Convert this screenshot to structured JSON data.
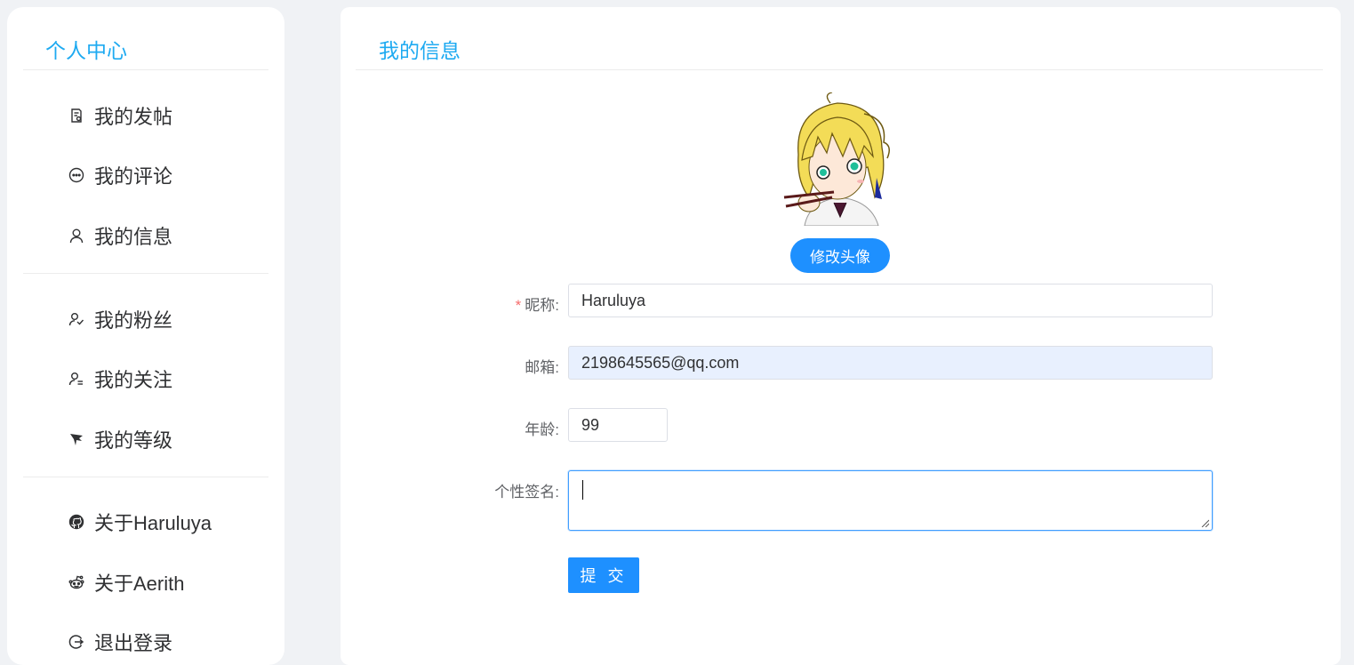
{
  "sidebar": {
    "title": "个人中心",
    "items": [
      {
        "label": "我的发帖",
        "icon": "document-icon"
      },
      {
        "label": "我的评论",
        "icon": "chat-bubble-icon"
      },
      {
        "label": "我的信息",
        "icon": "user-icon"
      },
      {
        "label": "我的粉丝",
        "icon": "followers-icon"
      },
      {
        "label": "我的关注",
        "icon": "following-icon"
      },
      {
        "label": "我的等级",
        "icon": "level-icon"
      },
      {
        "label": "关于Haruluya",
        "icon": "github-icon"
      },
      {
        "label": "关于Aerith",
        "icon": "reddit-icon"
      },
      {
        "label": "退出登录",
        "icon": "logout-icon"
      }
    ]
  },
  "main": {
    "title": "我的信息",
    "avatar_alt": "anime-character-avatar",
    "change_avatar_label": "修改头像",
    "form": {
      "nickname_label": "昵称:",
      "nickname_required_mark": "*",
      "nickname_value": "Haruluya",
      "email_label": "邮箱:",
      "email_value": "2198645565@qq.com",
      "age_label": "年龄:",
      "age_value": "99",
      "signature_label": "个性签名:",
      "signature_value": "",
      "submit_label": "提 交"
    }
  },
  "colors": {
    "accent": "#1eaaf1",
    "primary_button": "#1e90ff",
    "background": "#f0f2f5"
  }
}
